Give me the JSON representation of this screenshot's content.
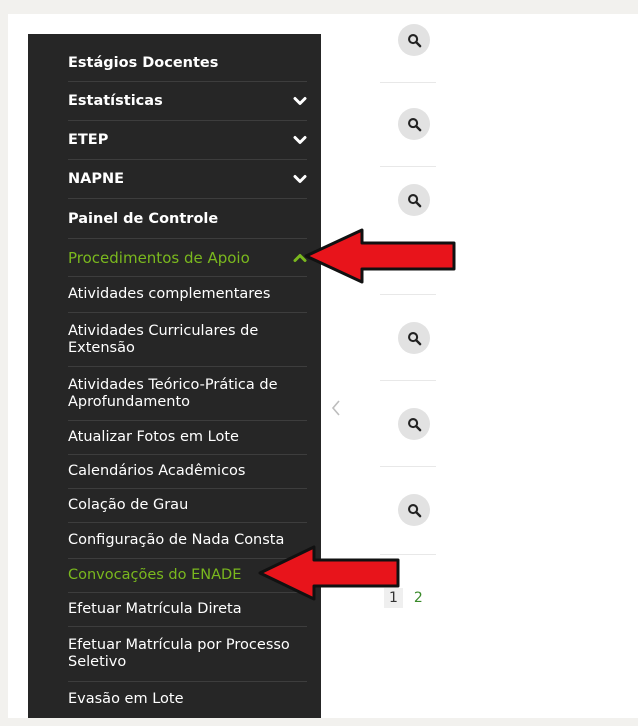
{
  "sidebar": {
    "items": [
      {
        "label": "Estágios Docentes",
        "type": "parent",
        "chevron": null
      },
      {
        "label": "Estatísticas",
        "type": "parent",
        "chevron": "down"
      },
      {
        "label": "ETEP",
        "type": "parent",
        "chevron": "down"
      },
      {
        "label": "NAPNE",
        "type": "parent",
        "chevron": "down"
      },
      {
        "label": "Painel de Controle",
        "type": "parent",
        "chevron": null
      },
      {
        "label": "Procedimentos de Apoio",
        "type": "parent-active",
        "chevron": "up"
      },
      {
        "label": "Atividades complementares",
        "type": "sub"
      },
      {
        "label": "Atividades Curriculares de Extensão",
        "type": "sub"
      },
      {
        "label": "Atividades Teórico-Prática de Aprofundamento",
        "type": "sub"
      },
      {
        "label": "Atualizar Fotos em Lote",
        "type": "sub"
      },
      {
        "label": "Calendários Acadêmicos",
        "type": "sub"
      },
      {
        "label": "Colação de Grau",
        "type": "sub"
      },
      {
        "label": "Configuração de Nada Consta",
        "type": "sub"
      },
      {
        "label": "Convocações do ENADE",
        "type": "sub-active"
      },
      {
        "label": "Efetuar Matrícula Direta",
        "type": "sub"
      },
      {
        "label": "Efetuar Matrícula por Processo Seletivo",
        "type": "sub"
      },
      {
        "label": "Evasão em Lote",
        "type": "sub"
      }
    ]
  },
  "pagination": {
    "pages": [
      "1",
      "2"
    ],
    "current": "1"
  },
  "colors": {
    "sidebar_bg": "#262626",
    "active_green": "#7ab81e",
    "arrow_red": "#e8141b"
  },
  "icons": {
    "row_action": "search-icon",
    "sidebar_toggle": "chevron-left-icon"
  }
}
